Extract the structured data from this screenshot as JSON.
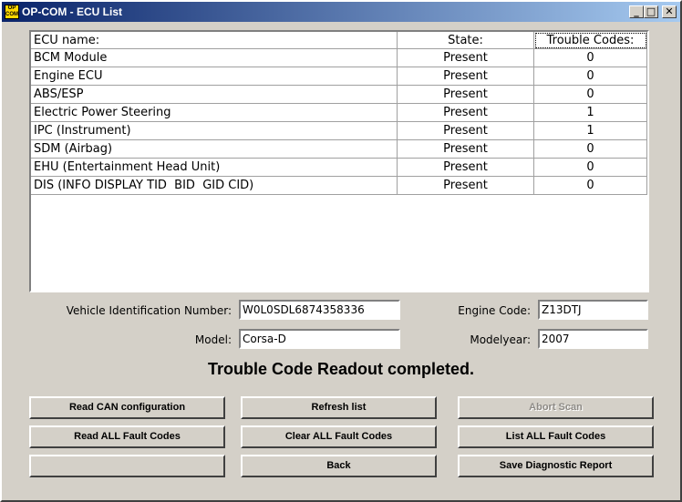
{
  "window": {
    "title": "OP-COM - ECU List",
    "icon_text": "OP COM",
    "controls": {
      "minimize": "_",
      "maximize": "□",
      "close": "✕"
    }
  },
  "ecu_table": {
    "columns": [
      "ECU name:",
      "State:",
      "Trouble Codes:"
    ],
    "rows": [
      {
        "name": "BCM Module",
        "state": "Present",
        "codes": "0"
      },
      {
        "name": "Engine ECU",
        "state": "Present",
        "codes": "0"
      },
      {
        "name": "ABS/ESP",
        "state": "Present",
        "codes": "0"
      },
      {
        "name": "Electric Power Steering",
        "state": "Present",
        "codes": "1"
      },
      {
        "name": "IPC (Instrument)",
        "state": "Present",
        "codes": "1"
      },
      {
        "name": "SDM (Airbag)",
        "state": "Present",
        "codes": "0"
      },
      {
        "name": "EHU (Entertainment Head Unit)",
        "state": "Present",
        "codes": "0"
      },
      {
        "name": "DIS (INFO DISPLAY TID  BID  GID CID)",
        "state": "Present",
        "codes": "0"
      }
    ]
  },
  "vehicle": {
    "vin_label": "Vehicle Identification Number:",
    "vin_value": "W0L0SDL6874358336",
    "engine_code_label": "Engine Code:",
    "engine_code_value": "Z13DTJ",
    "model_label": "Model:",
    "model_value": "Corsa-D",
    "modelyear_label": "Modelyear:",
    "modelyear_value": "2007"
  },
  "status_text": "Trouble Code Readout completed.",
  "buttons": {
    "read_can": "Read CAN configuration",
    "refresh": "Refresh list",
    "abort": "Abort Scan",
    "read_all": "Read ALL Fault Codes",
    "clear_all": "Clear ALL Fault Codes",
    "list_all": "List ALL Fault Codes",
    "blank": "",
    "back": "Back",
    "save": "Save Diagnostic Report"
  }
}
